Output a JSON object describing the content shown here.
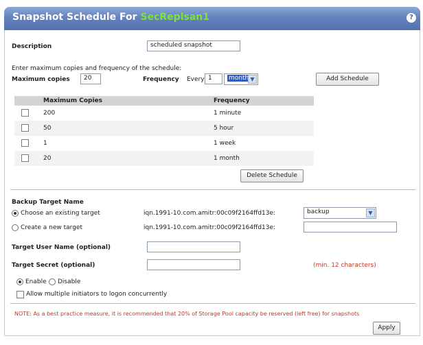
{
  "window": {
    "title_prefix": "Snapshot Schedule For",
    "title_volume": "SecReplsan1",
    "help_glyph": "?"
  },
  "description": {
    "label": "Description",
    "value": "scheduled snapshot"
  },
  "schedule": {
    "instructions": "Enter maximum copies and frequency of the schedule:",
    "max_copies_label": "Maximum copies",
    "max_copies_value": "20",
    "frequency_label": "Frequency",
    "every_label": "Every",
    "every_value": "1",
    "unit_value": "month",
    "add_button": "Add Schedule"
  },
  "table": {
    "columns": [
      "Maximum Copies",
      "Frequency"
    ],
    "rows": [
      {
        "copies": "200",
        "frequency": "1 minute"
      },
      {
        "copies": "50",
        "frequency": "5 hour"
      },
      {
        "copies": "1",
        "frequency": "1 week"
      },
      {
        "copies": "20",
        "frequency": "1 month"
      }
    ],
    "delete_button": "Delete Schedule"
  },
  "backup_target": {
    "heading": "Backup Target Name",
    "existing_label": "Choose an existing target",
    "existing_iqn": "iqn.1991-10.com.amitr:00c09f2164ffd13e:",
    "existing_selected": "backup",
    "new_label": "Create a new target",
    "new_iqn": "iqn.1991-10.com.amitr:00c09f2164ffd13e:",
    "new_value": ""
  },
  "credentials": {
    "user_label": "Target User Name (optional)",
    "user_value": "",
    "secret_label": "Target Secret (optional)",
    "secret_value": "",
    "secret_hint": "(min. 12 characters)"
  },
  "state": {
    "enable_label": "Enable",
    "disable_label": "Disable",
    "multi_initiator_label": "Allow multiple initiators to logon concurrently"
  },
  "footer": {
    "note": "NOTE: As a best practice measure, it is recommended that 20% of Storage Pool capacity be reserved (left free) for snapshots",
    "apply_button": "Apply"
  },
  "colors": {
    "title_bar": "#5f7dba",
    "title_accent": "#7fe03f",
    "note_red": "#c0392b",
    "table_header": "#d4d4d4"
  }
}
